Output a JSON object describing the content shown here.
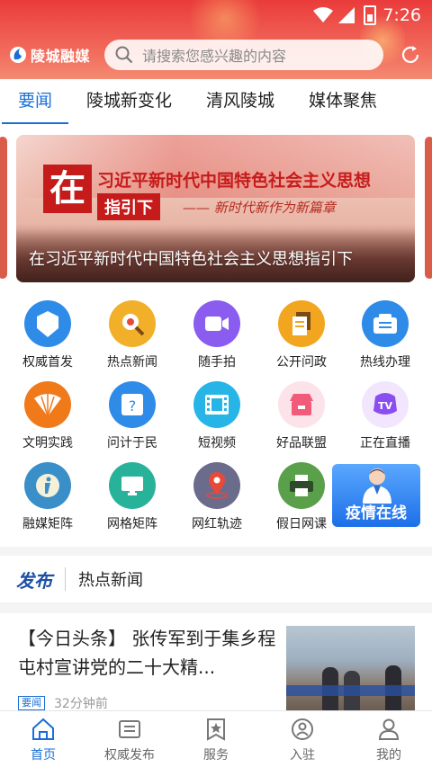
{
  "status_bar": {
    "time": "7:26"
  },
  "header": {
    "logo_text": "陵城融媒",
    "search_placeholder": "请搜索您感兴趣的内容"
  },
  "tabs": [
    {
      "label": "要闻",
      "active": true
    },
    {
      "label": "陵城新变化",
      "active": false
    },
    {
      "label": "清风陵城",
      "active": false
    },
    {
      "label": "媒体聚焦",
      "active": false
    }
  ],
  "banner": {
    "badge": "在",
    "headline_line1": "习近平新时代中国特色社会主义思想",
    "headline_line2": "指引下",
    "slogan": "—— 新时代新作为新篇章",
    "caption": "在习近平新时代中国特色社会主义思想指引下"
  },
  "grid": [
    {
      "label": "权威首发",
      "icon": "publish-icon",
      "color": "#2f8be8",
      "inner": "发布"
    },
    {
      "label": "热点新闻",
      "icon": "hot-news-icon",
      "color": "#f2b02a"
    },
    {
      "label": "随手拍",
      "icon": "video-camera-icon",
      "color": "#8a5cf0"
    },
    {
      "label": "公开问政",
      "icon": "documents-icon",
      "color": "#f2a51f"
    },
    {
      "label": "热线办理",
      "icon": "hotline-icon",
      "color": "#2f8be8"
    },
    {
      "label": "文明实践",
      "icon": "fan-icon",
      "color": "#f07a1a"
    },
    {
      "label": "问计于民",
      "icon": "ask-icon",
      "color": "#2f8be8",
      "inner": "问"
    },
    {
      "label": "短视频",
      "icon": "film-icon",
      "color": "#27b5e8"
    },
    {
      "label": "好品联盟",
      "icon": "shop-icon",
      "color": "#f25a7a"
    },
    {
      "label": "正在直播",
      "icon": "live-tv-icon",
      "color": "#8a4df0",
      "inner": "TV"
    },
    {
      "label": "融媒矩阵",
      "icon": "info-icon",
      "color": "#3a8fc8",
      "inner": "i"
    },
    {
      "label": "网格矩阵",
      "icon": "grid-matrix-icon",
      "color": "#29b29a"
    },
    {
      "label": "网红轨迹",
      "icon": "location-icon",
      "color": "#6b6b8c"
    },
    {
      "label": "假日网课",
      "icon": "printer-icon",
      "color": "#5aa04a"
    }
  ],
  "promo": {
    "label": "疫情在线"
  },
  "section": {
    "brand": "发布",
    "title": "热点新闻"
  },
  "news": {
    "title": "【今日头条】 张传军到于集乡程屯村宣讲党的二十大精...",
    "tag": "要闻",
    "time_ago": "32分钟前"
  },
  "bottom_nav": [
    {
      "label": "首页",
      "icon": "home-icon",
      "active": true
    },
    {
      "label": "权威发布",
      "icon": "announcement-icon",
      "active": false
    },
    {
      "label": "服务",
      "icon": "service-icon",
      "active": false
    },
    {
      "label": "入驻",
      "icon": "join-icon",
      "active": false
    },
    {
      "label": "我的",
      "icon": "profile-icon",
      "active": false
    }
  ],
  "colors": {
    "accent": "#1a6fd6",
    "header_red": "#ea3b3b"
  }
}
